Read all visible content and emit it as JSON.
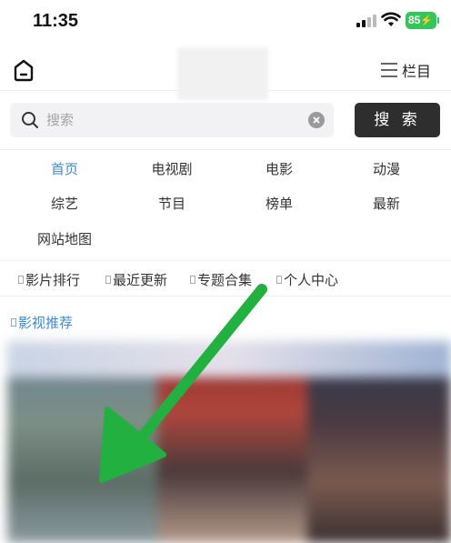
{
  "status_bar": {
    "time": "11:35",
    "battery": "85"
  },
  "header": {
    "menu_label": "栏目"
  },
  "search": {
    "placeholder": "搜索",
    "button_label": "搜 索"
  },
  "nav": {
    "items": [
      {
        "label": "首页",
        "active": true
      },
      {
        "label": "电视剧"
      },
      {
        "label": "电影"
      },
      {
        "label": "动漫"
      },
      {
        "label": "综艺"
      },
      {
        "label": "节目"
      },
      {
        "label": "榜单"
      },
      {
        "label": "最新"
      },
      {
        "label": "网站地图"
      }
    ]
  },
  "quick_links": [
    {
      "label": "影片排行"
    },
    {
      "label": "最近更新"
    },
    {
      "label": "专题合集"
    },
    {
      "label": "个人中心"
    }
  ],
  "section": {
    "title": "影视推荐"
  },
  "colors": {
    "accent_blue": "#3b8bd6",
    "search_button": "#2e2e2e",
    "battery_green": "#33c759",
    "arrow_green": "#22b140"
  }
}
